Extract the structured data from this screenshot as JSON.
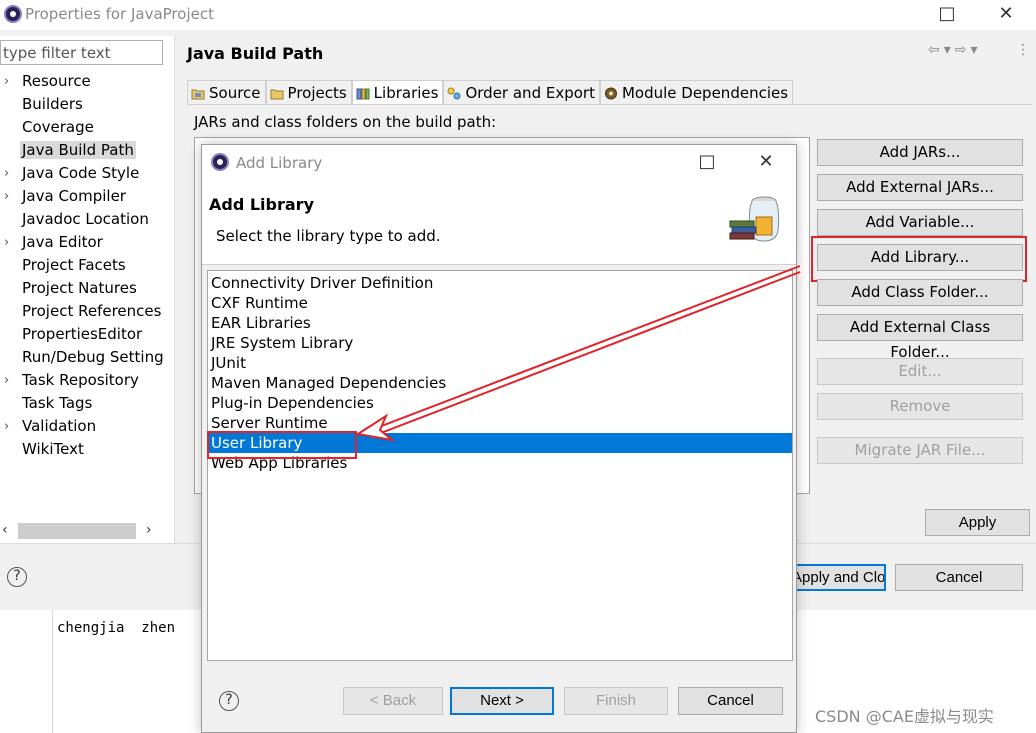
{
  "window": {
    "title": "Properties for JavaProject",
    "maximize_icon": "□",
    "close_icon": "✕"
  },
  "filter": {
    "placeholder": "type filter text"
  },
  "tree": {
    "items": [
      {
        "label": "Resource",
        "expandable": true
      },
      {
        "label": "Builders",
        "expandable": false
      },
      {
        "label": "Coverage",
        "expandable": false
      },
      {
        "label": "Java Build Path",
        "expandable": false,
        "selected": true
      },
      {
        "label": "Java Code Style",
        "expandable": true
      },
      {
        "label": "Java Compiler",
        "expandable": true
      },
      {
        "label": "Javadoc Location",
        "expandable": false
      },
      {
        "label": "Java Editor",
        "expandable": true
      },
      {
        "label": "Project Facets",
        "expandable": false
      },
      {
        "label": "Project Natures",
        "expandable": false
      },
      {
        "label": "Project References",
        "expandable": false
      },
      {
        "label": "PropertiesEditor",
        "expandable": false
      },
      {
        "label": "Run/Debug Setting",
        "expandable": false
      },
      {
        "label": "Task Repository",
        "expandable": true
      },
      {
        "label": "Task Tags",
        "expandable": false
      },
      {
        "label": "Validation",
        "expandable": true
      },
      {
        "label": "WikiText",
        "expandable": false
      }
    ]
  },
  "page": {
    "title": "Java Build Path",
    "tabs": [
      "Source",
      "Projects",
      "Libraries",
      "Order and Export",
      "Module Dependencies"
    ],
    "active_tab": "Libraries",
    "description": "JARs and class folders on the build path:"
  },
  "side_buttons": {
    "add_jars": "Add JARs...",
    "add_external_jars": "Add External JARs...",
    "add_variable": "Add Variable...",
    "add_library": "Add Library...",
    "add_class_folder": "Add Class Folder...",
    "add_external_class_folder": "Add External Class Folder...",
    "edit": "Edit...",
    "remove": "Remove",
    "migrate_jar": "Migrate JAR File..."
  },
  "footer": {
    "apply": "Apply",
    "apply_and_close": "Apply and Close",
    "cancel": "Cancel",
    "help": "?"
  },
  "console": {
    "output": "chengjia  zhen"
  },
  "dialog": {
    "title": "Add Library",
    "heading": "Add Library",
    "subtitle": "Select the library type to add.",
    "library_types": [
      "Connectivity Driver Definition",
      "CXF Runtime",
      "EAR Libraries",
      "JRE System Library",
      "JUnit",
      "Maven Managed Dependencies",
      "Plug-in Dependencies",
      "Server Runtime",
      "User Library",
      "Web App Libraries"
    ],
    "selected_type": "User Library",
    "buttons": {
      "back": "< Back",
      "next": "Next >",
      "finish": "Finish",
      "cancel": "Cancel",
      "help": "?"
    },
    "maximize_icon": "□",
    "close_icon": "✕"
  },
  "annotation": {
    "color": "#e0242a"
  },
  "watermark": "CSDN @CAE虚拟与现实",
  "colors": {
    "selection": "#0078d7",
    "window_bg": "#f0f0f0"
  }
}
